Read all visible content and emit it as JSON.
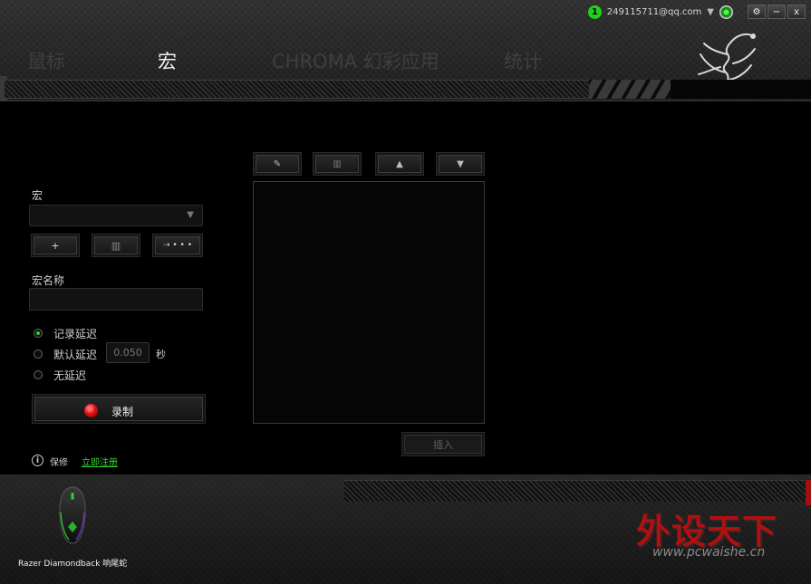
{
  "account": {
    "notification_count": "1",
    "email": "249115711@qq.com",
    "caret": "▼"
  },
  "window_controls": {
    "settings": "⚙",
    "minimize": "−",
    "close": "x"
  },
  "nav": {
    "tabs": [
      {
        "label": "鼠标"
      },
      {
        "label": "宏"
      },
      {
        "label": "CHROMA 幻彩应用"
      },
      {
        "label": "统计"
      }
    ]
  },
  "macro_panel": {
    "macro_label": "宏",
    "dropdown_caret": "▼",
    "add_button": "+",
    "delete_icon": "▥",
    "more_button": "⇢ • • •",
    "name_label": "宏名称",
    "delay_options": [
      {
        "label": "记录延迟",
        "selected": true
      },
      {
        "label": "默认延迟",
        "selected": false
      },
      {
        "label": "无延迟",
        "selected": false
      }
    ],
    "default_delay_value": "0.050",
    "seconds_label": "秒",
    "record_label": "录制"
  },
  "editor": {
    "edit_icon": "✎",
    "delete_icon": "▥",
    "up_icon": "▲",
    "down_icon": "▼",
    "insert_label": "插入"
  },
  "footer": {
    "info_icon": "i",
    "warranty_label": "保修",
    "register_link": "立即注册",
    "device_name": "Razer Diamondback 响尾蛇",
    "watermark_title": "外设天下",
    "watermark_url": "www.pcwaishe.cn"
  },
  "colors": {
    "accent_green": "#2ed62e",
    "record_red": "#e01010",
    "background": "#000000"
  }
}
